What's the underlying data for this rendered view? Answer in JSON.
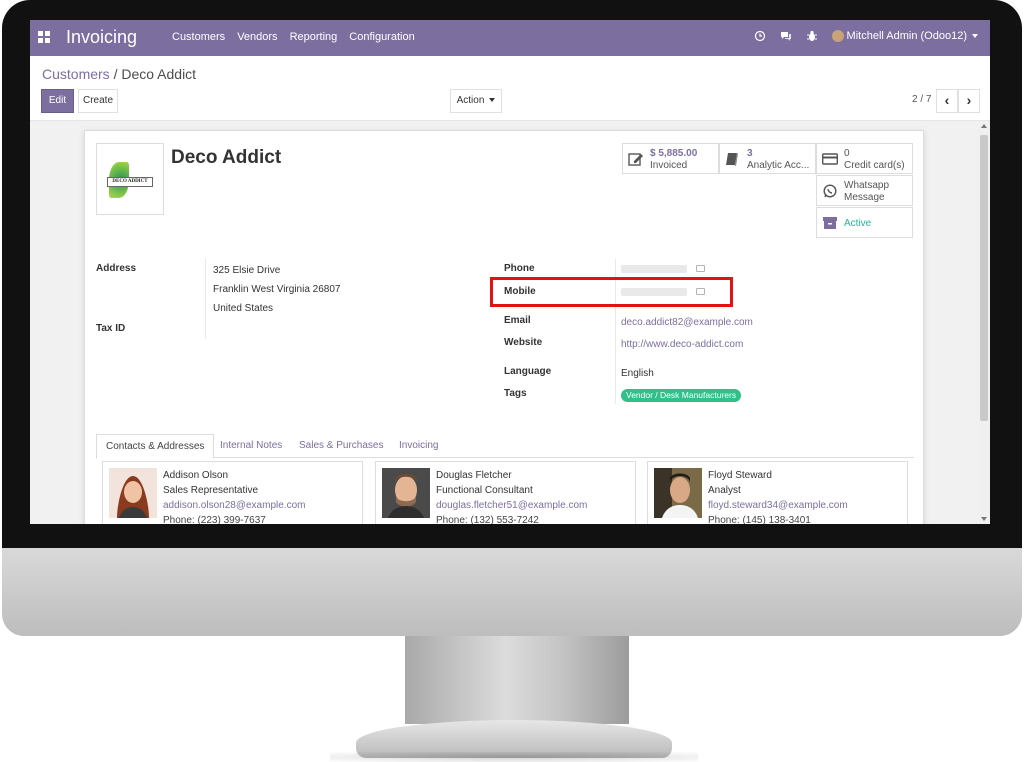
{
  "navbar": {
    "app_title": "Invoicing",
    "menu": [
      "Customers",
      "Vendors",
      "Reporting",
      "Configuration"
    ],
    "user": "Mitchell Admin (Odoo12)",
    "icons": [
      "clock-icon",
      "chat-icon",
      "bug-icon"
    ],
    "color": "#7c6f9f"
  },
  "breadcrumb": {
    "parent": "Customers",
    "separator": " / ",
    "current": "Deco Addict"
  },
  "toolbar": {
    "edit_label": "Edit",
    "create_label": "Create",
    "action_label": "Action"
  },
  "pager": {
    "text": "2 / 7",
    "prev": "‹",
    "next": "›"
  },
  "partner": {
    "name": "Deco Addict",
    "logo_text": "DECO ADDICT",
    "stats": {
      "invoiced_value": "$ 5,885.00",
      "invoiced_label": "Invoiced",
      "analytic_value": "3",
      "analytic_label": "Analytic Acc...",
      "cards_value": "0",
      "cards_label": "Credit card(s)",
      "whatsapp_line1": "Whatsapp",
      "whatsapp_line2": "Message",
      "active_label": "Active"
    },
    "labels": {
      "address": "Address",
      "tax_id": "Tax ID",
      "phone": "Phone",
      "mobile": "Mobile",
      "email": "Email",
      "website": "Website",
      "language": "Language",
      "tags": "Tags"
    },
    "address": {
      "street": "325 Elsie Drive",
      "city_line": "Franklin  West Virginia  26807",
      "country": "United States"
    },
    "email": "deco.addict82@example.com",
    "website": "http://www.deco-addict.com",
    "language": "English",
    "tag": "Vendor / Desk Manufacturers"
  },
  "tabs": [
    "Contacts & Addresses",
    "Internal Notes",
    "Sales & Purchases",
    "Invoicing"
  ],
  "contacts": [
    {
      "name": "Addison Olson",
      "role": "Sales Representative",
      "email": "addison.olson28@example.com",
      "phone": "Phone: (223) 399-7637"
    },
    {
      "name": "Douglas Fletcher",
      "role": "Functional Consultant",
      "email": "douglas.fletcher51@example.com",
      "phone": "Phone: (132) 553-7242"
    },
    {
      "name": "Floyd Steward",
      "role": "Analyst",
      "email": "floyd.steward34@example.com",
      "phone": "Phone: (145) 138-3401"
    }
  ],
  "colors": {
    "accent": "#7c6f9f",
    "tag": "#30c08a",
    "active": "#21b799",
    "highlight": "#e31212"
  }
}
